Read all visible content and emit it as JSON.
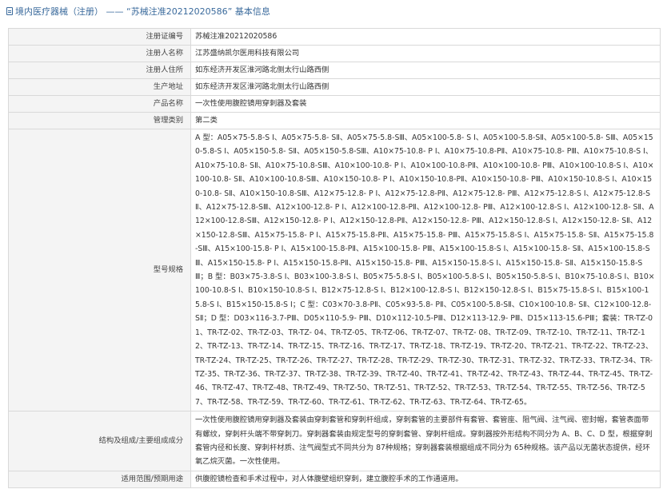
{
  "header": {
    "title": "境内医疗器械（注册） —— “苏械注准20212020586” 基本信息"
  },
  "rows": [
    {
      "label": "注册证编号",
      "value": "苏械注准20212020586"
    },
    {
      "label": "注册人名称",
      "value": "江苏盛纳凯尔医用科技有限公司"
    },
    {
      "label": "注册人住所",
      "value": "如东经济开发区淮河路北侧太行山路西侧"
    },
    {
      "label": "生产地址",
      "value": "如东经济开发区淮河路北侧太行山路西侧"
    },
    {
      "label": "产品名称",
      "value": "一次性使用腹腔镜用穿刺器及套装"
    },
    {
      "label": "管理类别",
      "value": "第二类"
    },
    {
      "label": "型号规格",
      "value": "A 型：A05×75-5.8-S Ⅰ、A05×75-5.8- SⅡ、A05×75-5.8-SⅢ、A05×100-5.8- S Ⅰ、A05×100-5.8-SⅡ、A05×100-5.8- SⅢ、A05×150-5.8-S Ⅰ、A05×150-5.8- SⅡ、A05×150-5.8-SⅢ、A10×75-10.8- P Ⅰ、A10×75-10.8-PⅡ、A10×75-10.8- PⅢ、A10×75-10.8-S Ⅰ、A10×75-10.8- SⅡ、A10×75-10.8-SⅢ、A10×100-10.8- P Ⅰ、A10×100-10.8-PⅡ、A10×100-10.8- PⅢ、A10×100-10.8-S Ⅰ、A10×100-10.8- SⅡ、A10×100-10.8-SⅢ、A10×150-10.8- P Ⅰ、A10×150-10.8-PⅡ、A10×150-10.8- PⅢ、A10×150-10.8-S Ⅰ、A10×150-10.8- SⅡ、A10×150-10.8-SⅢ、A12×75-12.8- P Ⅰ、A12×75-12.8-PⅡ、A12×75-12.8- PⅢ、A12×75-12.8-S Ⅰ、A12×75-12.8-SⅡ、A12×75-12.8-SⅢ、A12×100-12.8- P Ⅰ、A12×100-12.8-PⅡ、A12×100-12.8- PⅢ、A12×100-12.8-S Ⅰ、A12×100-12.8- SⅡ、A12×100-12.8-SⅢ、A12×150-12.8- P Ⅰ、A12×150-12.8-PⅡ、A12×150-12.8- PⅢ、A12×150-12.8-S Ⅰ、A12×150-12.8- SⅡ、A12×150-12.8-SⅢ、A15×75-15.8- P Ⅰ、A15×75-15.8-PⅡ、A15×75-15.8- PⅢ、A15×75-15.8-S Ⅰ、A15×75-15.8- SⅡ、A15×75-15.8-SⅢ、A15×100-15.8- P Ⅰ、A15×100-15.8-PⅡ、A15×100-15.8- PⅢ、A15×100-15.8-S Ⅰ、A15×100-15.8- SⅡ、A15×100-15.8-SⅢ、A15×150-15.8- P Ⅰ、A15×150-15.8-PⅡ、A15×150-15.8- PⅢ、A15×150-15.8-S Ⅰ、A15×150-15.8- SⅡ、A15×150-15.8-SⅢ；B 型：B03×75-3.8-S Ⅰ、B03×100-3.8-S Ⅰ、B05×75-5.8-S Ⅰ、B05×100-5.8-S Ⅰ、B05×150-5.8-S Ⅰ、B10×75-10.8-S Ⅰ、B10×100-10.8-S Ⅰ、B10×150-10.8-S Ⅰ、B12×75-12.8-S Ⅰ、B12×100-12.8-S Ⅰ、B12×150-12.8-S Ⅰ、B15×75-15.8-S Ⅰ、B15×100-15.8-S Ⅰ、B15×150-15.8-S Ⅰ；C 型：C03×70-3.8-PⅡ、C05×93-5.8- PⅡ、C05×100-5.8-SⅡ、C10×100-10.8- SⅡ、C12×100-12.8-SⅡ；D 型：D03×116-3.7-PⅢ、D05×110-5.9- PⅢ、D10×112-10.5-PⅢ、D12×113-12.9- PⅢ、D15×113-15.6-PⅢ；套装：TR-TZ-01、TR-TZ-02、TR-TZ-03、TR-TZ- 04、TR-TZ-05、TR-TZ-06、TR-TZ-07、TR-TZ- 08、TR-TZ-09、TR-TZ-10、TR-TZ-11、TR-TZ-12、TR-TZ-13、TR-TZ-14、TR-TZ-15、TR-TZ-16、TR-TZ-17、TR-TZ-18、TR-TZ-19、TR-TZ-20、TR-TZ-21、TR-TZ-22、TR-TZ-23、TR-TZ-24、TR-TZ-25、TR-TZ-26、TR-TZ-27、TR-TZ-28、TR-TZ-29、TR-TZ-30、TR-TZ-31、TR-TZ-32、TR-TZ-33、TR-TZ-34、TR-TZ-35、TR-TZ-36、TR-TZ-37、TR-TZ-38、TR-TZ-39、TR-TZ-40、TR-TZ-41、TR-TZ-42、TR-TZ-43、TR-TZ-44、TR-TZ-45、TR-TZ-46、TR-TZ-47、TR-TZ-48、TR-TZ-49、TR-TZ-50、TR-TZ-51、TR-TZ-52、TR-TZ-53、TR-TZ-54、TR-TZ-55、TR-TZ-56、TR-TZ-57、TR-TZ-58、TR-TZ-59、TR-TZ-60、TR-TZ-61、TR-TZ-62、TR-TZ-63、TR-TZ-64、TR-TZ-65。"
    },
    {
      "label": "结构及组成/主要组成成分",
      "value": "一次性使用腹腔镜用穿刺器及套装由穿刺套管和穿刺杆组成，穿刺套管的主要部件有套管、套管座、阻气阀、注气阀、密封帽，套管表面带有螺纹，穿刺杆头端不带穿刺刀。穿刺器套装由规定型号的穿刺套管、穿刺杆组成。穿刺器按外形结构不同分为 A、B、C、D 型，根据穿刺套管内径和长度、穿刺杆材质、注气阀型式不同共分为 87种规格；穿刺器套装根据组成不同分为 65种规格。该产品以无菌状态提供，经环氧乙烷灭菌。一次性使用。"
    },
    {
      "label": "适用范围/预期用途",
      "value": "供腹腔镜检查和手术过程中，对人体腹壁组织穿刺，建立腹腔手术的工作通道用。"
    }
  ]
}
